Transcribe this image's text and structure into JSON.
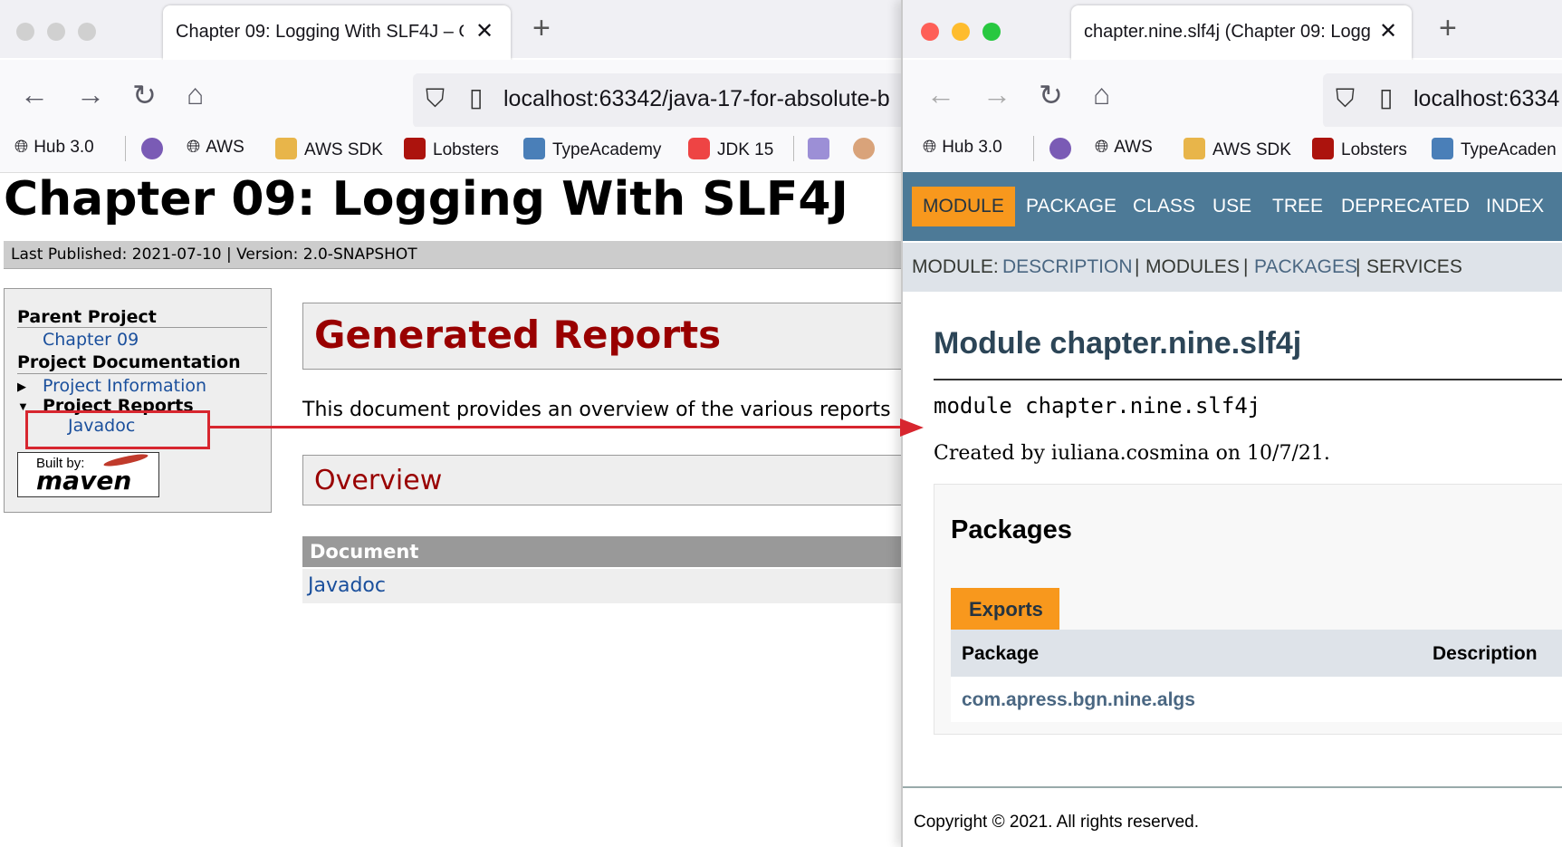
{
  "left_window": {
    "tab_title": "Chapter 09: Logging With SLF4J – G",
    "url": "localhost:63342/java-17-for-absolute-b",
    "bookmarks": [
      "Hub 3.0",
      "AWS",
      "AWS SDK",
      "Lobsters",
      "TypeAcademy",
      "JDK 15"
    ],
    "page": {
      "title": "Chapter 09: Logging With SLF4J",
      "published": "Last Published: 2021-07-10  | Version: 2.0-SNAPSHOT",
      "nav": {
        "parent_heading": "Parent Project",
        "parent_link": "Chapter 09",
        "docs_heading": "Project Documentation",
        "project_information": "Project Information",
        "project_reports": "Project Reports",
        "javadoc": "Javadoc",
        "built_by": "Built by:",
        "maven": "maven"
      },
      "section_title": "Generated Reports",
      "intro": "This document provides an overview of the various reports",
      "overview": "Overview",
      "table_header": "Document",
      "table_row": "Javadoc"
    }
  },
  "right_window": {
    "tab_title": "chapter.nine.slf4j (Chapter 09: Logg",
    "url": "localhost:6334",
    "bookmarks": [
      "Hub 3.0",
      "AWS",
      "AWS SDK",
      "Lobsters",
      "TypeAcaden"
    ],
    "javadoc_nav": [
      "MODULE",
      "PACKAGE",
      "CLASS",
      "USE",
      "TREE",
      "DEPRECATED",
      "INDEX"
    ],
    "subnav": {
      "prefix": "MODULE:",
      "description": "DESCRIPTION",
      "sep1": "|",
      "modules": "MODULES",
      "sep2": "|",
      "packages": "PACKAGES",
      "sep3": "|",
      "services": "SERVICES"
    },
    "module_title": "Module chapter.nine.slf4j",
    "module_decl": "module chapter.nine.slf4j",
    "created_by": "Created by iuliana.cosmina on 10/7/21.",
    "packages_heading": "Packages",
    "exports_tab": "Exports",
    "col_package": "Package",
    "col_description": "Description",
    "package_name": "com.apress.bgn.nine.algs",
    "footer": "Copyright © 2021. All rights reserved."
  },
  "colors": {
    "javadoc_nav_bg": "#4d7a97",
    "javadoc_active": "#f8981d",
    "annotation_red": "#d7262f",
    "maven_title_red": "#990000"
  }
}
